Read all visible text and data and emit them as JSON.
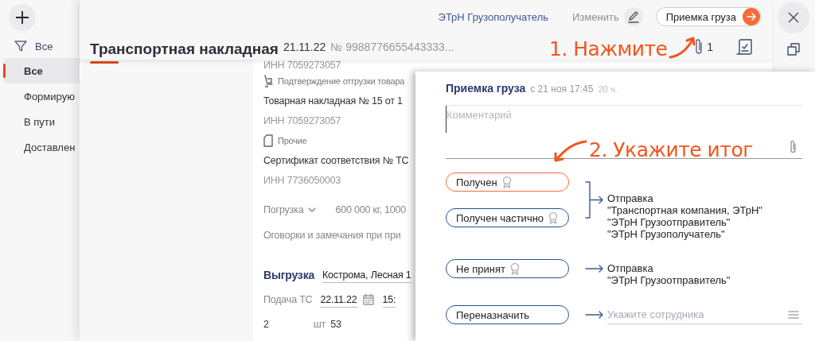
{
  "sidebar": {
    "filter": "Все",
    "items": [
      {
        "label": "Все",
        "selected": true
      },
      {
        "label": "Формирую",
        "selected": false
      },
      {
        "label": "В пути",
        "selected": false
      },
      {
        "label": "Доставлен",
        "selected": false
      }
    ]
  },
  "header": {
    "recipient_link": "ЭТрН Грузополучатель",
    "edit_link": "Изменить",
    "action_button": "Приемка груза",
    "title": "Транспортная накладная",
    "date": "21.11.22",
    "number": "№ 9988776655443333...",
    "attachments_count": "1"
  },
  "document": {
    "lines": [
      {
        "kind": "inn",
        "text": "ИНН 7059273057"
      },
      {
        "kind": "shipping",
        "text": "Подтверждение отгрузки товара"
      },
      {
        "kind": "doc",
        "text": "Товарная накладная № 15 от 1"
      },
      {
        "kind": "inn",
        "text": "ИНН 7059273057"
      },
      {
        "kind": "misc",
        "text": "Прочие"
      },
      {
        "kind": "doc",
        "text": "Сертификат соответствия № ТС"
      },
      {
        "kind": "inn",
        "text": "ИНН 7736050003"
      }
    ],
    "loading": {
      "label": "Погрузка",
      "summary": "600 000 кг, 1000"
    },
    "remarks": "Оговорки и замечания при при",
    "unloading": {
      "label": "Выгрузка",
      "address": "Кострома, Лесная 1",
      "supply_label": "Подача ТС",
      "date": "22.11.22",
      "time": "15:"
    },
    "cargo": {
      "count": "2",
      "unit": "шт",
      "value": "53"
    }
  },
  "popup": {
    "title": "Приемка груза",
    "from": "с 21 ноя 17:45",
    "duration": "20 ч.",
    "comment_placeholder": "Комментарий",
    "outcomes": [
      {
        "options": [
          {
            "label": "Получен",
            "selected": true,
            "seal": true
          },
          {
            "label": "Получен частично",
            "selected": false,
            "seal": true
          }
        ],
        "target": {
          "kind": "text",
          "lines": [
            "Отправка",
            "\"Транспортная компания, ЭТрН\"",
            "\"ЭТрН Грузоотправитель\"",
            "\"ЭТрН Грузополучатель\""
          ]
        }
      },
      {
        "options": [
          {
            "label": "Не принят",
            "selected": false,
            "seal": true
          }
        ],
        "target": {
          "kind": "text",
          "lines": [
            "Отправка",
            "\"ЭТрН Грузоотправитель\""
          ]
        }
      },
      {
        "options": [
          {
            "label": "Переназначить",
            "selected": false,
            "seal": false
          }
        ],
        "target": {
          "kind": "field",
          "placeholder": "Укажите сотрудника"
        }
      }
    ]
  },
  "annotations": [
    "1. Нажмите",
    "2. Укажите итог"
  ]
}
